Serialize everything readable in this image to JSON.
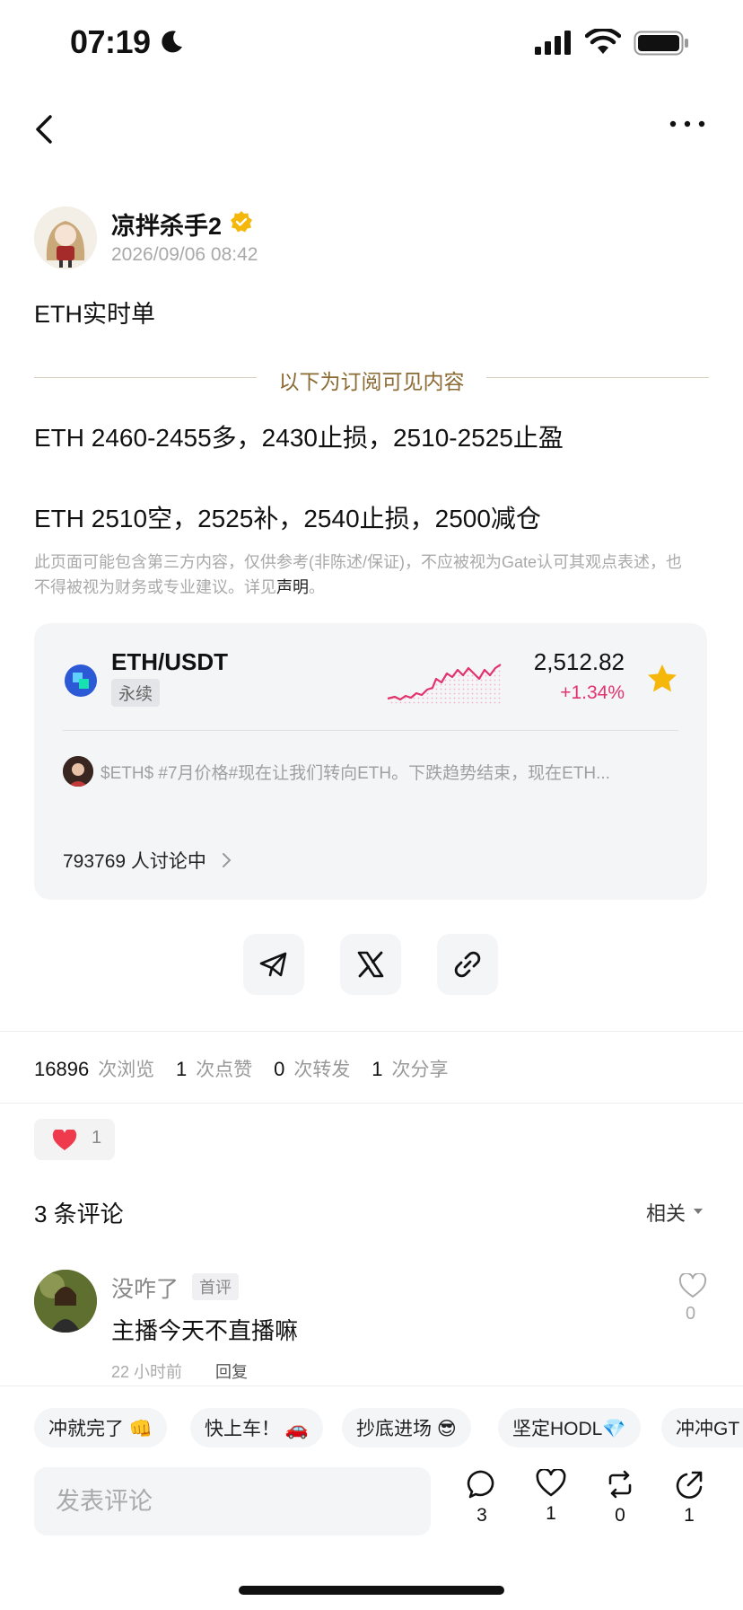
{
  "status": {
    "time": "07:19"
  },
  "post": {
    "author": "凉拌杀手2",
    "date": "2026/09/06 08:42",
    "title": "ETH实时单",
    "subscription_label": "以下为订阅可见内容",
    "line1": "ETH 2460-2455多，2430止损，2510-2525止盈",
    "line2": "ETH 2510空，2525补，2540止损，2500减仓",
    "disclaimer_text": "此页面可能包含第三方内容，仅供参考(非陈述/保证)，不应被视为Gate认可其观点表述，也不得被视为财务或专业建议。详见",
    "disclaimer_link": "声明",
    "disclaimer_end": "。"
  },
  "market_card": {
    "pair": "ETH/USDT",
    "tag": "永续",
    "price": "2,512.82",
    "change": "+1.34%",
    "snippet": "$ETH$ #7月价格#现在让我们转向ETH。下跌趋势结束，现在ETH...",
    "discussion": "793769 人讨论中",
    "accent_color": "#e2336c",
    "star_color": "#f5b70a"
  },
  "stats": {
    "views": "16896",
    "views_label": "次浏览",
    "likes": "1",
    "likes_label": "次点赞",
    "reposts": "0",
    "reposts_label": "次转发",
    "shares": "1",
    "shares_label": "次分享"
  },
  "reaction": {
    "count": "1"
  },
  "comments": {
    "title": "3 条评论",
    "sort_label": "相关",
    "items": [
      {
        "name": "没咋了",
        "badge": "首评",
        "text": "主播今天不直播嘛",
        "time": "22 小时前",
        "reply": "回复",
        "likes": "0"
      }
    ]
  },
  "quick_replies": [
    "冲就完了 👊",
    "快上车！ 🚗",
    "抄底进场 😎",
    "坚定HODL💎",
    "冲冲GT"
  ],
  "composer": {
    "placeholder": "发表评论"
  },
  "actions": {
    "comments": "3",
    "likes": "1",
    "reposts": "0",
    "shares": "1"
  }
}
